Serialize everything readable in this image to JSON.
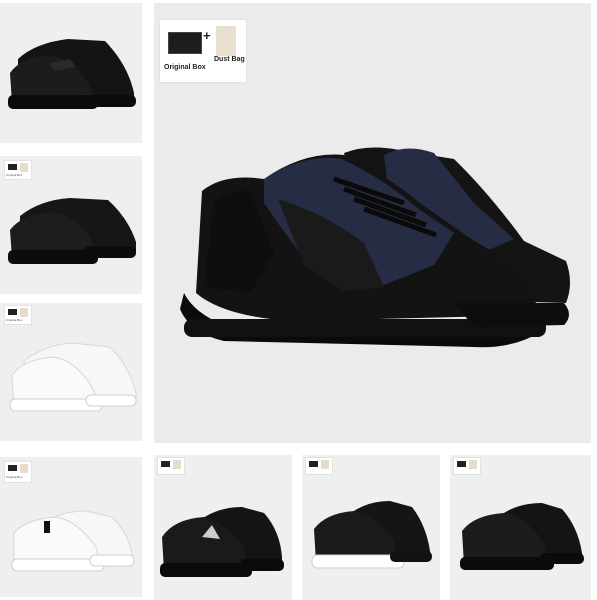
{
  "main_badge": {
    "box_label": "Original Box",
    "plus": "+",
    "bag_label": "Dust Bag"
  },
  "mini_badge": {
    "box_label": "Original Box",
    "bag_label": "Dust Bag"
  },
  "thumbnails": [
    {
      "id": "thumb-1",
      "shoe_color": "black-fabric",
      "has_badge": false
    },
    {
      "id": "thumb-2",
      "shoe_color": "black-leather",
      "has_badge": true
    },
    {
      "id": "thumb-3",
      "shoe_color": "white-leather",
      "has_badge": true
    },
    {
      "id": "thumb-4",
      "shoe_color": "white-leather",
      "has_badge": true
    },
    {
      "id": "thumb-5",
      "shoe_color": "black-leather",
      "has_badge": true
    },
    {
      "id": "thumb-6",
      "shoe_color": "black-white-sole",
      "has_badge": true
    },
    {
      "id": "thumb-7",
      "shoe_color": "black-leather",
      "has_badge": true
    }
  ],
  "main_product": {
    "shoe_color": "navy-black"
  },
  "colors": {
    "tile_bg": "#ebebeb",
    "navy": "#272c45",
    "black": "#111111",
    "white": "#f6f6f6"
  }
}
